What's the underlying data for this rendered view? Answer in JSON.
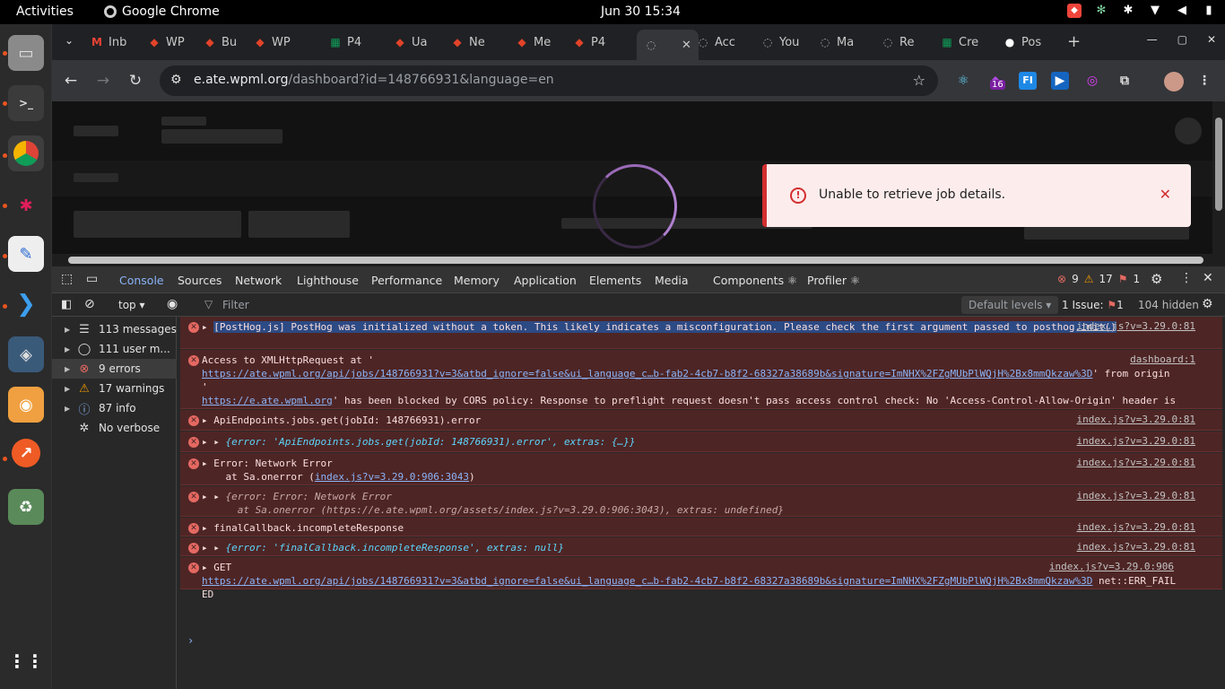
{
  "topbar": {
    "activities": "Activities",
    "app_name": "Google Chrome",
    "clock": "Jun 30  15:34"
  },
  "browser": {
    "tabs": [
      {
        "label": "Inb",
        "icon": "gmail-icon",
        "color": "#ea4335"
      },
      {
        "label": "WP",
        "icon": "gitlab-icon",
        "color": "#e24329"
      },
      {
        "label": "Bu",
        "icon": "gitlab-icon",
        "color": "#e24329"
      },
      {
        "label": "WP",
        "icon": "gitlab-icon",
        "color": "#e24329"
      },
      {
        "label": "P4",
        "icon": "sheets-icon",
        "color": "#0f9d58"
      },
      {
        "label": "Ua",
        "icon": "jira-icon",
        "color": "#e24329"
      },
      {
        "label": "Ne",
        "icon": "gitlab-icon",
        "color": "#e24329"
      },
      {
        "label": "Me",
        "icon": "gitlab-icon",
        "color": "#e24329"
      },
      {
        "label": "P4",
        "icon": "doc-icon",
        "color": "#e24329"
      },
      {
        "label": "",
        "icon": "loading-icon",
        "color": "#aaaaaa"
      },
      {
        "label": "Acc",
        "icon": "loading-icon",
        "color": "#aaaaaa"
      },
      {
        "label": "You",
        "icon": "loading-icon",
        "color": "#aaaaaa"
      },
      {
        "label": "Ma",
        "icon": "loading-icon",
        "color": "#aaaaaa"
      },
      {
        "label": "Re",
        "icon": "loading-icon",
        "color": "#aaaaaa"
      },
      {
        "label": "Cre",
        "icon": "sheets-icon",
        "color": "#0f9d58"
      },
      {
        "label": "Pos",
        "icon": "github-icon",
        "color": "#ffffff"
      }
    ],
    "url_host": "e.ate.wpml.org",
    "url_path": "/dashboard?id=148766931&language=en",
    "extension_badge": "16"
  },
  "page": {
    "toast_message": "Unable to retrieve job details.",
    "toast_color": "#d32f2f"
  },
  "devtools": {
    "tabs": [
      "Console",
      "Sources",
      "Network",
      "Lighthouse",
      "Performance",
      "Memory",
      "Application",
      "Elements",
      "Media",
      "Components ⚛",
      "Profiler ⚛"
    ],
    "counts": {
      "errors": "9",
      "warnings": "17",
      "issues_badge": "1"
    },
    "context": "top",
    "filter_placeholder": "Filter",
    "levels": "Default levels",
    "issues_label": "1 Issue:",
    "issues_count": "1",
    "hidden": "104 hidden",
    "sidebar": [
      {
        "label": "113 messages",
        "icon": "list-icon"
      },
      {
        "label": "111 user m...",
        "icon": "user-icon"
      },
      {
        "label": "9 errors",
        "icon": "error-icon"
      },
      {
        "label": "17 warnings",
        "icon": "warning-icon"
      },
      {
        "label": "87 info",
        "icon": "info-icon"
      },
      {
        "label": "No verbose",
        "icon": "bug-icon"
      }
    ],
    "messages": [
      {
        "text": "[PostHog.js] PostHog was initialized without a token. This likely indicates a misconfiguration. Please check the first argument passed to posthog.init()",
        "source": "index.js?v=3.29.0:81"
      },
      {
        "text": "Access to XMLHttpRequest at '",
        "link": "https://ate.wpml.org/api/jobs/148766931?v=3&atbd_ignore=false&ui_language_c…b-fab2-4cb7-b8f2-68327a38689b&signature=ImNHX%2FZgMUbPlWQjH%2Bx8mmQkzaw%3D",
        "text2": "' from origin '",
        "link2": "https://e.ate.wpml.org",
        "text3": "' has been blocked by CORS policy: Response to preflight request doesn't pass access control check: No 'Access-Control-Allow-Origin' header is present on the requested resource.",
        "source": "dashboard:1"
      },
      {
        "text": "ApiEndpoints.jobs.get(jobId: 148766931).error",
        "source": "index.js?v=3.29.0:81"
      },
      {
        "text": "{error: 'ApiEndpoints.jobs.get(jobId: 148766931).error', extras: {…}}",
        "source": "index.js?v=3.29.0:81"
      },
      {
        "text": "Error: Network Error",
        "text2": "at Sa.onerror (",
        "link": "index.js?v=3.29.0:906:3043",
        "text3": ")",
        "source": "index.js?v=3.29.0:81"
      },
      {
        "text": "{error: Error: Network Error",
        "text2": "at Sa.onerror (https://e.ate.wpml.org/assets/index.js?v=3.29.0:906:3043), extras: undefined}",
        "source": "index.js?v=3.29.0:81"
      },
      {
        "text": "finalCallback.incompleteResponse",
        "source": "index.js?v=3.29.0:81"
      },
      {
        "text": "{error: 'finalCallback.incompleteResponse', extras: null}",
        "source": "index.js?v=3.29.0:81"
      },
      {
        "text": "GET",
        "link": "https://ate.wpml.org/api/jobs/148766931?v=3&atbd_ignore=false&ui_language_c…b-fab2-4cb7-b8f2-68327a38689b&signature=ImNHX%2FZgMUbPlWQjH%2Bx8mmQkzaw%3D",
        "text2": "net::ERR_FAILED",
        "source": "index.js?v=3.29.0:906"
      }
    ]
  }
}
